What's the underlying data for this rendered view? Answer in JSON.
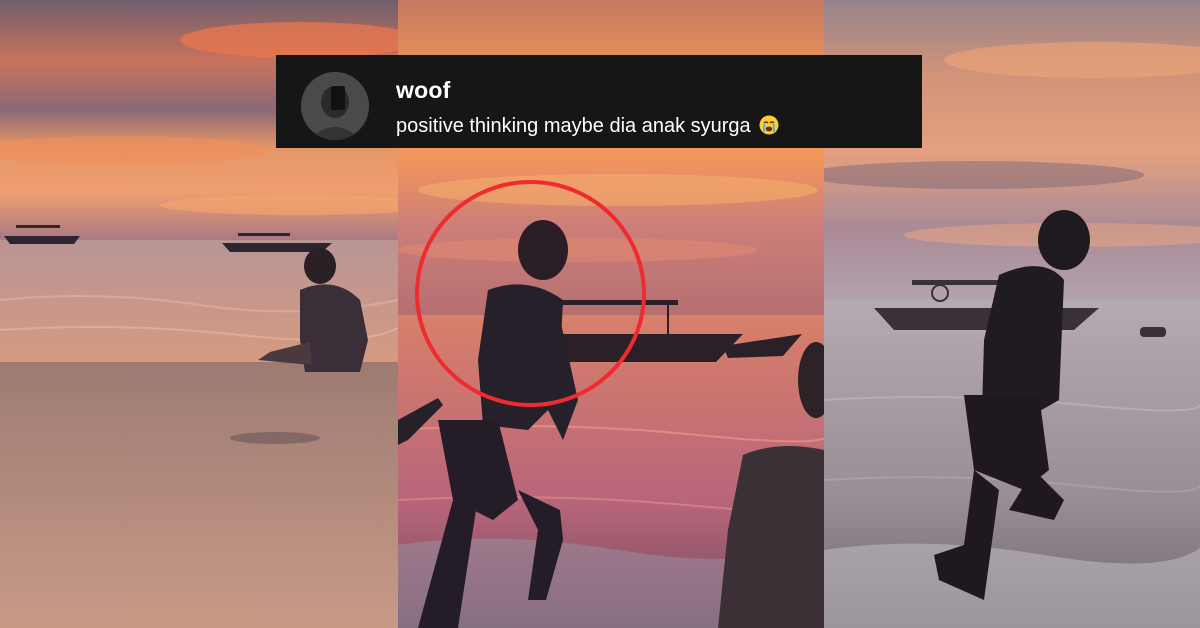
{
  "comment": {
    "username": "woof",
    "text": "positive thinking maybe dia anak syurga",
    "emoji_icon": "loudly-crying-face-icon"
  },
  "highlight": {
    "color": "#ee2b2e"
  },
  "colors": {
    "sunset_orange": "#f08a4b",
    "sky_purple": "#6e5060",
    "sea": "#b8857c",
    "overlay_bg": "#161616"
  }
}
